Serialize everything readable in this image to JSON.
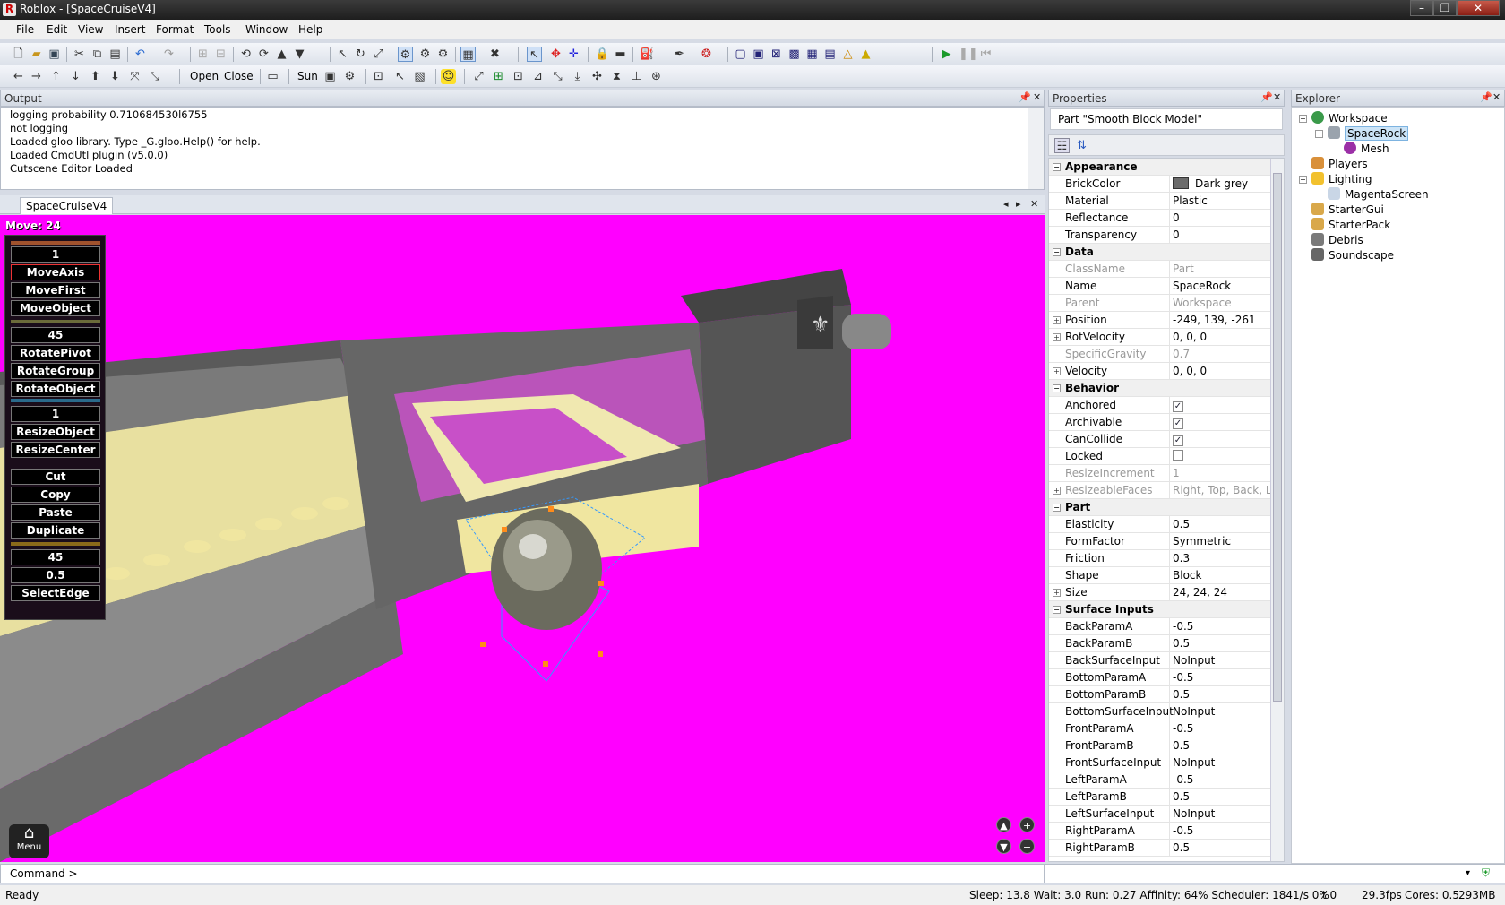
{
  "window": {
    "title": "Roblox - [SpaceCruiseV4]",
    "min": "–",
    "max": "❐",
    "close": "✕"
  },
  "menu": [
    "File",
    "Edit",
    "View",
    "Insert",
    "Format",
    "Tools",
    "Window",
    "Help"
  ],
  "toolbar2": {
    "open": "Open",
    "close": "Close",
    "sun": "Sun"
  },
  "output": {
    "title": "Output",
    "lines": [
      "logging probability 0.710684530l6755",
      "not logging",
      "Loaded gloo library. Type _G.gloo.Help() for help.",
      "Loaded CmdUtl plugin (v5.0.0)",
      "Cutscene Editor Loaded"
    ]
  },
  "document": {
    "tab": "SpaceCruiseV4"
  },
  "viewport": {
    "move_label": "Move: 24",
    "gui": [
      {
        "label": "1"
      },
      {
        "label": "MoveAxis"
      },
      {
        "label": "MoveFirst"
      },
      {
        "label": "MoveObject"
      },
      {
        "label": "45"
      },
      {
        "label": "RotatePivot"
      },
      {
        "label": "RotateGroup"
      },
      {
        "label": "RotateObject"
      },
      {
        "label": "1"
      },
      {
        "label": "ResizeObject"
      },
      {
        "label": "ResizeCenter"
      },
      {
        "label": "Cut"
      },
      {
        "label": "Copy"
      },
      {
        "label": "Paste"
      },
      {
        "label": "Duplicate"
      },
      {
        "label": "45"
      },
      {
        "label": "0.5"
      },
      {
        "label": "SelectEdge"
      }
    ],
    "menu_label": "Menu"
  },
  "properties": {
    "title": "Properties",
    "header": "Part \"Smooth Block Model\"",
    "rows": [
      {
        "type": "cat",
        "name": "Appearance"
      },
      {
        "name": "BrickColor",
        "value": "Dark grey",
        "swatch": "#6b6b6b"
      },
      {
        "name": "Material",
        "value": "Plastic"
      },
      {
        "name": "Reflectance",
        "value": "0"
      },
      {
        "name": "Transparency",
        "value": "0"
      },
      {
        "type": "cat",
        "name": "Data"
      },
      {
        "name": "ClassName",
        "value": "Part",
        "disabled": true
      },
      {
        "name": "Name",
        "value": "SpaceRock"
      },
      {
        "name": "Parent",
        "value": "Workspace",
        "disabled": true
      },
      {
        "name": "Position",
        "value": "-249, 139, -261",
        "expand": true
      },
      {
        "name": "RotVelocity",
        "value": "0, 0, 0",
        "expand": true
      },
      {
        "name": "SpecificGravity",
        "value": "0.7",
        "disabled": true
      },
      {
        "name": "Velocity",
        "value": "0, 0, 0",
        "expand": true
      },
      {
        "type": "cat",
        "name": "Behavior"
      },
      {
        "name": "Anchored",
        "check": true
      },
      {
        "name": "Archivable",
        "check": true
      },
      {
        "name": "CanCollide",
        "check": true
      },
      {
        "name": "Locked",
        "check": false
      },
      {
        "name": "ResizeIncrement",
        "value": "1",
        "disabled": true
      },
      {
        "name": "ResizeableFaces",
        "value": "Right, Top, Back, Lef",
        "disabled": true,
        "expand": true
      },
      {
        "type": "cat",
        "name": "Part"
      },
      {
        "name": "Elasticity",
        "value": "0.5"
      },
      {
        "name": "FormFactor",
        "value": "Symmetric"
      },
      {
        "name": "Friction",
        "value": "0.3"
      },
      {
        "name": "Shape",
        "value": "Block"
      },
      {
        "name": "Size",
        "value": "24, 24, 24",
        "expand": true
      },
      {
        "type": "cat",
        "name": "Surface Inputs"
      },
      {
        "name": "BackParamA",
        "value": "-0.5"
      },
      {
        "name": "BackParamB",
        "value": "0.5"
      },
      {
        "name": "BackSurfaceInput",
        "value": "NoInput"
      },
      {
        "name": "BottomParamA",
        "value": "-0.5"
      },
      {
        "name": "BottomParamB",
        "value": "0.5"
      },
      {
        "name": "BottomSurfaceInput",
        "value": "NoInput"
      },
      {
        "name": "FrontParamA",
        "value": "-0.5"
      },
      {
        "name": "FrontParamB",
        "value": "0.5"
      },
      {
        "name": "FrontSurfaceInput",
        "value": "NoInput"
      },
      {
        "name": "LeftParamA",
        "value": "-0.5"
      },
      {
        "name": "LeftParamB",
        "value": "0.5"
      },
      {
        "name": "LeftSurfaceInput",
        "value": "NoInput"
      },
      {
        "name": "RightParamA",
        "value": "-0.5"
      },
      {
        "name": "RightParamB",
        "value": "0.5"
      }
    ]
  },
  "explorer": {
    "title": "Explorer",
    "items": [
      {
        "label": "Workspace",
        "icon": "workspace-icon",
        "color": "#3a9a4a",
        "level": 0,
        "expander": "+"
      },
      {
        "label": "SpaceRock",
        "icon": "part-icon",
        "color": "#9aa3ad",
        "level": 1,
        "expander": "−",
        "selected": true
      },
      {
        "label": "Mesh",
        "icon": "mesh-icon",
        "color": "#9b2fa6",
        "level": 2
      },
      {
        "label": "Players",
        "icon": "players-icon",
        "color": "#d9903a",
        "level": 0
      },
      {
        "label": "Lighting",
        "icon": "lighting-icon",
        "color": "#f2c12e",
        "level": 0,
        "expander": "+"
      },
      {
        "label": "MagentaScreen",
        "icon": "sky-icon",
        "color": "#c9d6e6",
        "level": 1
      },
      {
        "label": "StarterGui",
        "icon": "folder-icon",
        "color": "#d9a84a",
        "level": 0
      },
      {
        "label": "StarterPack",
        "icon": "folder-icon",
        "color": "#d9a84a",
        "level": 0
      },
      {
        "label": "Debris",
        "icon": "debris-icon",
        "color": "#7a7a7a",
        "level": 0
      },
      {
        "label": "Soundscape",
        "icon": "sound-icon",
        "color": "#666666",
        "level": 0
      }
    ]
  },
  "command": {
    "label": "Command >"
  },
  "status": {
    "ready": "Ready",
    "stats": "Sleep: 13.8 Wait: 3.0 Run: 0.27 Affinity: 64% Scheduler: 1841/s 0%",
    "t": "t 0",
    "fps": "29.3fps",
    "cores": "Cores: 0.5",
    "mem": "293MB"
  },
  "colors": {
    "viewport": "#ff00ff",
    "selection": "#3399ff"
  }
}
